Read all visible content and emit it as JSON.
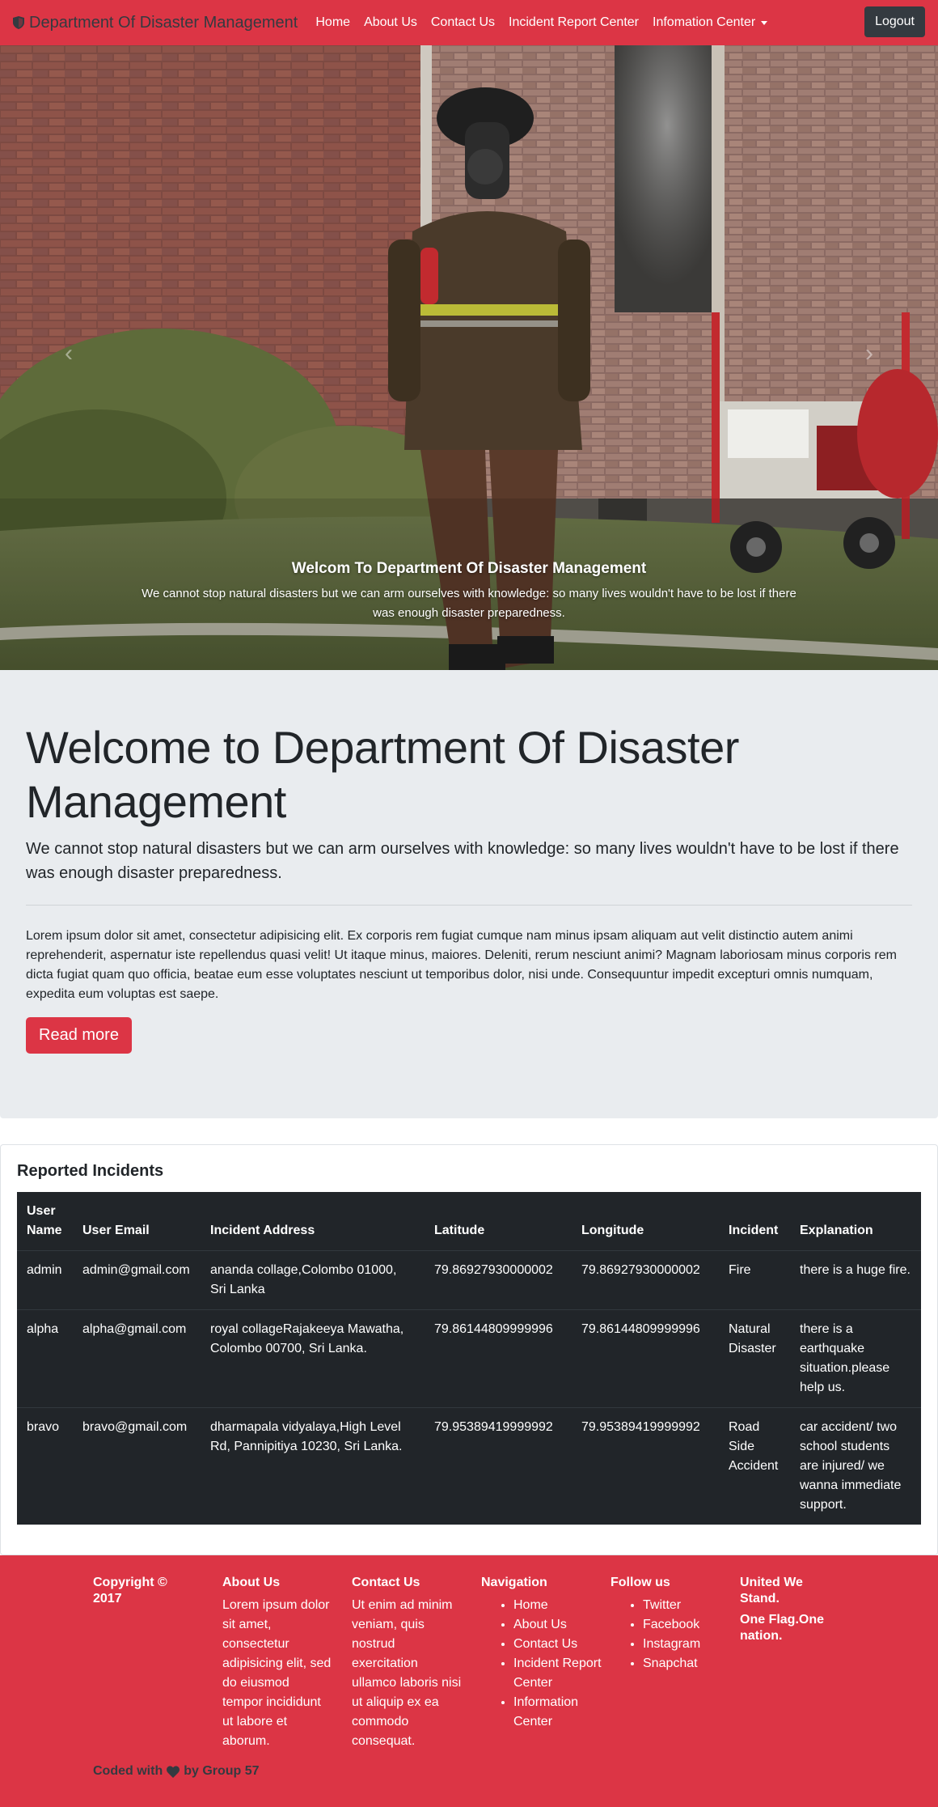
{
  "navbar": {
    "brand": "Department Of Disaster Management",
    "brand_icon": "shield-icon",
    "links": [
      {
        "label": "Home"
      },
      {
        "label": "About Us"
      },
      {
        "label": "Contact Us"
      },
      {
        "label": "Incident Report Center"
      },
      {
        "label": "Infomation Center"
      }
    ],
    "logout_label": "Logout"
  },
  "hero": {
    "image": "firefighter-with-breathing-apparatus-in-front-of-brick-building",
    "caption_title": "Welcom To Department Of Disaster Management",
    "caption_text": "We cannot stop natural disasters but we can arm ourselves with knowledge: so many lives wouldn't have to be lost if there was enough disaster preparedness."
  },
  "jumbotron": {
    "title": "Welcome to Department Of Disaster Management",
    "lead": "We cannot stop natural disasters but we can arm ourselves with knowledge: so many lives wouldn't have to be lost if there was enough disaster preparedness.",
    "body": "Lorem ipsum dolor sit amet, consectetur adipisicing elit. Ex corporis rem fugiat cumque nam minus ipsam aliquam aut velit distinctio autem animi reprehenderit, aspernatur iste repellendus quasi velit! Ut itaque minus, maiores. Deleniti, rerum nesciunt animi? Magnam laboriosam minus corporis rem dicta fugiat quam quo officia, beatae eum esse voluptates nesciunt ut temporibus dolor, nisi unde. Consequuntur impedit excepturi omnis numquam, expedita eum voluptas est saepe.",
    "button_label": "Read more"
  },
  "incidents": {
    "title": "Reported Incidents",
    "headers": [
      "User Name",
      "User Email",
      "Incident Address",
      "Latitude",
      "Longitude",
      "Incident",
      "Explanation"
    ],
    "rows": [
      [
        "admin",
        "admin@gmail.com",
        "ananda collage,Colombo 01000, Sri Lanka",
        "79.86927930000002",
        "79.86927930000002",
        "Fire",
        "there is a huge fire."
      ],
      [
        "alpha",
        "alpha@gmail.com",
        "royal collageRajakeeya Mawatha, Colombo 00700, Sri Lanka.",
        "79.86144809999996",
        "79.86144809999996",
        "Natural Disaster",
        "there is a earthquake situation.please help us."
      ],
      [
        "bravo",
        "bravo@gmail.com",
        "dharmapala vidyalaya,High Level Rd, Pannipitiya 10230, Sri Lanka.",
        "79.95389419999992",
        "79.95389419999992",
        "Road Side Accident",
        "car accident/ two school students are injured/ we wanna immediate support."
      ]
    ]
  },
  "footer": {
    "copyright": "Copyright © 2017",
    "about_title": "About Us",
    "about_text": "Lorem ipsum dolor sit amet, consectetur adipisicing elit, sed do eiusmod tempor incididunt ut labore et aborum.",
    "contact_title": "Contact Us",
    "contact_text": "Ut enim ad minim veniam, quis nostrud exercitation ullamco laboris nisi ut aliquip ex ea commodo consequat.",
    "navigation_title": "Navigation",
    "navigation_items": [
      "Home",
      "About Us",
      "Contact Us",
      "Incident Report Center",
      "Information Center"
    ],
    "follow_title": "Follow us",
    "follow_items": [
      "Twitter",
      "Facebook",
      "Instagram",
      "Snapchat"
    ],
    "unity_title": "United We Stand.",
    "unity_text": "One Flag.One nation.",
    "coded_prefix": "Coded with",
    "coded_suffix": "by Group 57",
    "heart_icon": "heart-icon"
  },
  "colors": {
    "brand_red": "#dc3545",
    "dark": "#343a40",
    "table_dark": "#212529",
    "jumbotron_bg": "#e9ecef"
  }
}
